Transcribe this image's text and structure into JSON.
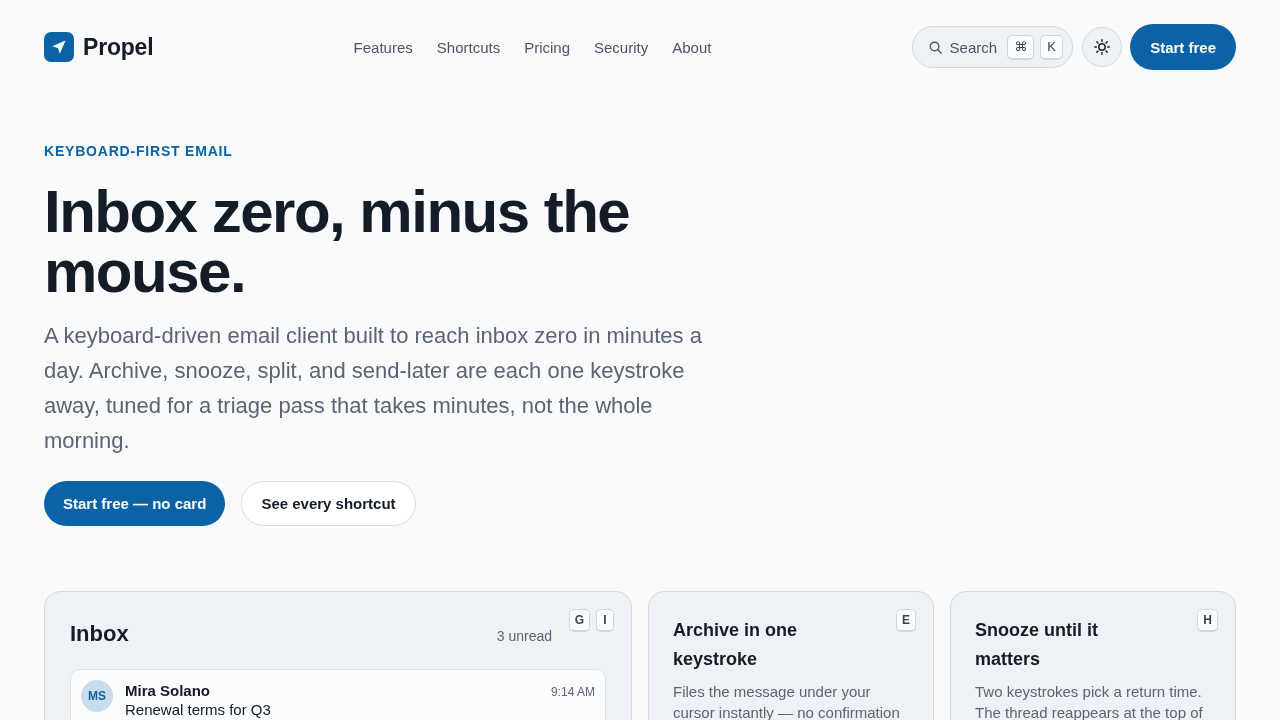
{
  "header": {
    "brand": "Propel",
    "nav": [
      "Features",
      "Shortcuts",
      "Pricing",
      "Security",
      "About"
    ],
    "search": {
      "label": "Search",
      "keys": [
        "⌘",
        "K"
      ]
    },
    "cta": "Start free"
  },
  "hero": {
    "eyebrow": "KEYBOARD-FIRST EMAIL",
    "title": "Inbox zero, minus the mouse.",
    "lead": "A keyboard-driven email client built to reach inbox zero in minutes a day. Archive, snooze, split, and send-later are each one keystroke away, tuned for a triage pass that takes minutes, not the whole morning.",
    "buttons": [
      {
        "label": "Start free — no card",
        "kind": "primary"
      },
      {
        "label": "See every shortcut",
        "kind": "secondary"
      }
    ]
  },
  "cards": [
    {
      "kind": "inbox",
      "title": "Inbox",
      "count": "3 unread",
      "keys": [
        "G",
        "I"
      ],
      "messages": [
        {
          "initials": "MS",
          "sender": "Mira Solano",
          "time": "9:14 AM",
          "subject": "Renewal terms for Q3"
        }
      ]
    },
    {
      "kind": "feature",
      "title": "Archive in one keystroke",
      "keys": [
        "E"
      ],
      "description": "Files the message under your cursor instantly — no confirmation"
    },
    {
      "kind": "feature",
      "title": "Snooze until it matters",
      "keys": [
        "H"
      ],
      "description": "Two keystrokes pick a return time. The thread reappears at the top of"
    }
  ]
}
